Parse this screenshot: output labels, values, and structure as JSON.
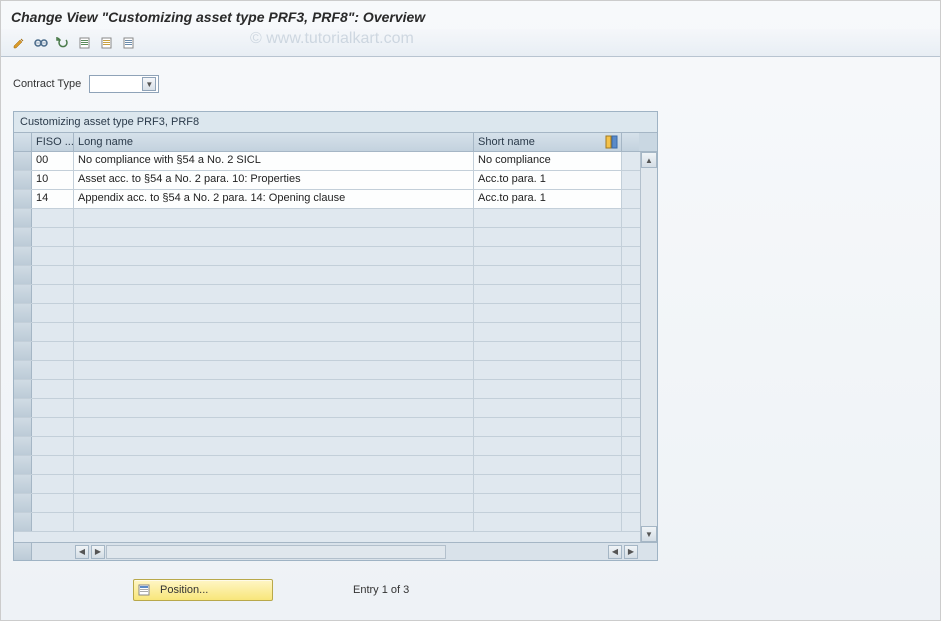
{
  "title": "Change View \"Customizing asset type PRF3, PRF8\": Overview",
  "watermark": "© www.tutorialkart.com",
  "toolbar": {
    "icons": [
      "display-change",
      "glasses",
      "undo",
      "new-entries",
      "copy",
      "delete"
    ]
  },
  "selection": {
    "label": "Contract Type",
    "value": ""
  },
  "panel": {
    "title": "Customizing asset type PRF3, PRF8",
    "columns": {
      "fiso": "FISO ...",
      "long": "Long name",
      "short": "Short name"
    },
    "rows": [
      {
        "fiso": "00",
        "long": "No compliance with §54 a No. 2 SICL",
        "short": "No compliance"
      },
      {
        "fiso": "10",
        "long": "Asset acc. to §54 a No. 2 para. 10: Properties",
        "short": "Acc.to para. 1"
      },
      {
        "fiso": "14",
        "long": "Appendix acc. to §54 a No. 2 para. 14: Opening clause",
        "short": "Acc.to para. 1"
      }
    ],
    "empty_rows": 17
  },
  "footer": {
    "position_label": "Position...",
    "entry_text": "Entry 1 of 3"
  }
}
